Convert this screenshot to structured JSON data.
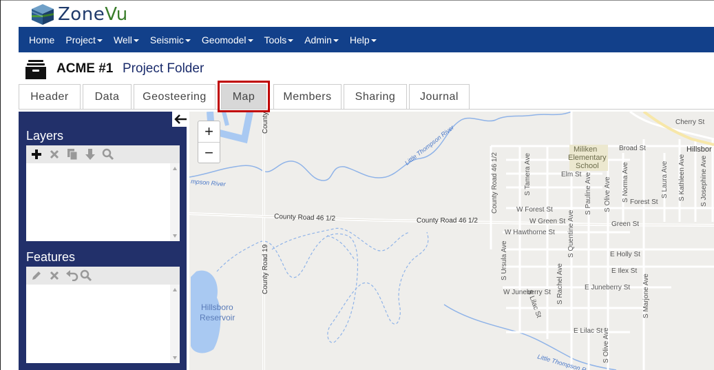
{
  "app": {
    "brand_prefix": "Zone",
    "brand_suffix": "Vu"
  },
  "nav": [
    {
      "label": "Home",
      "dropdown": false
    },
    {
      "label": "Project",
      "dropdown": true
    },
    {
      "label": "Well",
      "dropdown": true
    },
    {
      "label": "Seismic",
      "dropdown": true
    },
    {
      "label": "Geomodel",
      "dropdown": true
    },
    {
      "label": "Tools",
      "dropdown": true
    },
    {
      "label": "Admin",
      "dropdown": true
    },
    {
      "label": "Help",
      "dropdown": true
    }
  ],
  "header": {
    "project_name": "ACME #1",
    "subtitle": "Project Folder"
  },
  "tabs": [
    {
      "label": "Header"
    },
    {
      "label": "Data"
    },
    {
      "label": "Geosteering"
    },
    {
      "label": "Map",
      "active": true
    },
    {
      "label": "Members"
    },
    {
      "label": "Sharing"
    },
    {
      "label": "Journal"
    }
  ],
  "sidebar": {
    "layers": {
      "title": "Layers",
      "tools": [
        "add-icon",
        "delete-icon",
        "copy-icon",
        "download-icon",
        "search-icon"
      ]
    },
    "features": {
      "title": "Features",
      "tools": [
        "edit-icon",
        "delete-icon",
        "undo-icon",
        "search-icon"
      ]
    }
  },
  "map": {
    "zoom_in": "+",
    "zoom_out": "−",
    "labels": {
      "county_road_46_half_a": "County Road 46 1/2",
      "county_road_46_half_b": "County Road 46 1/2",
      "county_road_19": "County Road 19",
      "county_top": "County",
      "little_thompson_river_1": "Little Thompson River",
      "little_thompson_river_2": "Little Thompson R",
      "mpson_river": "mpson River",
      "hillsboro_reservoir_1": "Hillsboro",
      "hillsboro_reservoir_2": "Reservoir",
      "school_1": "Miliken",
      "school_2": "Elementary",
      "school_3": "School",
      "cherry_st": "Cherry St",
      "broad_st": "Broad St",
      "hillsboro_town": "Hillsbor",
      "elm_st": "Elm St",
      "w_forest_st": "W Forest St",
      "forest_st": "Forest St",
      "w_green_st": "W Green St",
      "green_st": "Green St",
      "w_hawthorne_st": "W Hawthorne St",
      "e_holly_st": "E Holly St",
      "e_ilex_st": "E Ilex St",
      "e_juneberry_st": "E Juneberry St",
      "w_juneberry_st": "W Juneberry St",
      "e_lilac_st": "E Lilac St",
      "county_road_46_vert": "County Road 46 1/2",
      "s_tamera_ave": "S Tamera Ave",
      "s_pauline_ave": "S Pauline Ave",
      "s_olive_ave": "S Olive Ave",
      "s_norma_ave": "S Norma Ave",
      "s_laura_ave": "S Laura Ave",
      "s_kathleen_ave": "S Kathleen Ave",
      "s_josephine_ave": "S Josephine Ave",
      "s_ursula_ave": "S Ursula Ave",
      "s_quentine_ave": "S Quentine Ave",
      "s_rachel_ave": "S Rachel Ave",
      "s_lilac_st": "S Lilac St",
      "s_marjone_ave": "S Marjone Ave",
      "s_olive_ave_2": "S Olive Ave"
    }
  }
}
